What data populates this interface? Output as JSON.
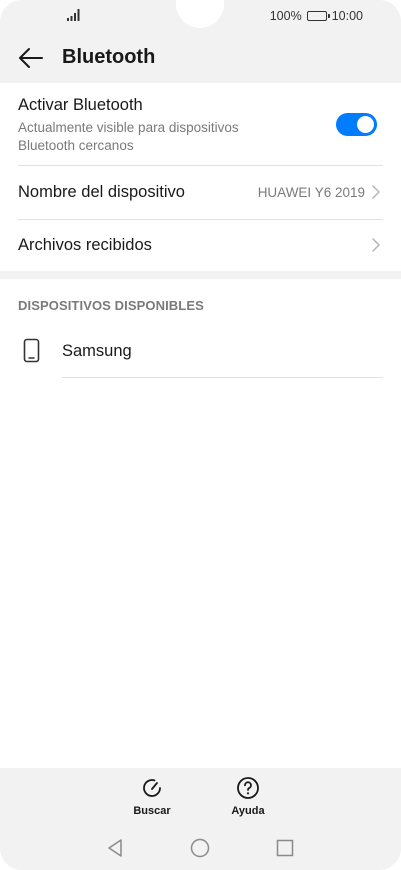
{
  "status_bar": {
    "battery": "100%",
    "time": "10:00"
  },
  "header": {
    "title": "Bluetooth",
    "back_icon": "arrow-left-icon"
  },
  "bluetooth_toggle": {
    "label": "Activar Bluetooth",
    "description": "Actualmente visible para dispositivos Bluetooth cercanos",
    "enabled": true,
    "accent_color": "#007dff"
  },
  "device_name": {
    "label": "Nombre del dispositivo",
    "value": "HUAWEI Y6 2019"
  },
  "received_files": {
    "label": "Archivos recibidos"
  },
  "available_devices": {
    "header": "DISPOSITIVOS DISPONIBLES",
    "items": [
      {
        "name": "Samsung",
        "icon": "smartphone-icon"
      }
    ]
  },
  "actions": {
    "search_label": "Buscar",
    "help_label": "Ayuda"
  },
  "navigation": {
    "back_icon": "triangle-back-icon",
    "home_icon": "circle-home-icon",
    "recents_icon": "square-recents-icon"
  }
}
